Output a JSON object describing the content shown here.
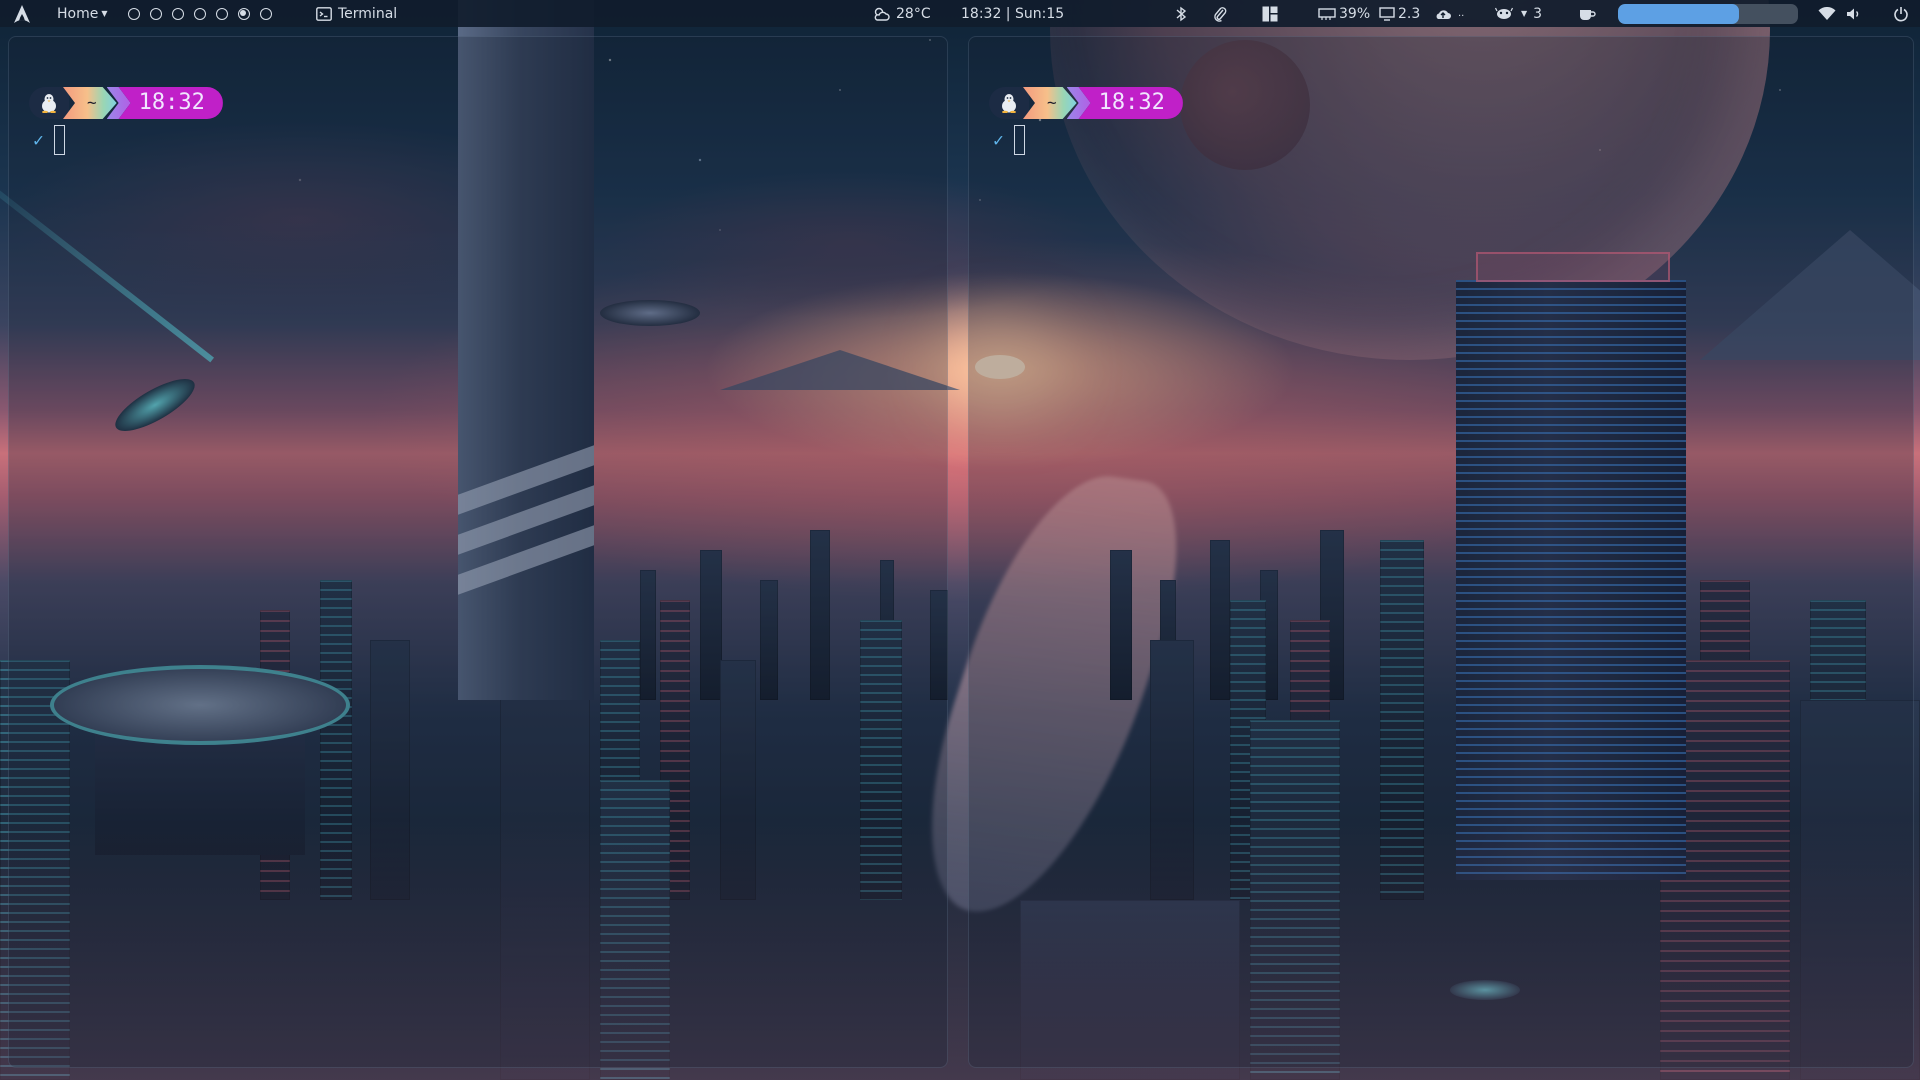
{
  "panel": {
    "launcher_icon": "arch-linux-icon",
    "home_menu": {
      "label": "Home",
      "icon": "caret-down-icon"
    },
    "workspaces": [
      {
        "active": false
      },
      {
        "active": false
      },
      {
        "active": false
      },
      {
        "active": false
      },
      {
        "active": false
      },
      {
        "active": true
      },
      {
        "active": false
      }
    ],
    "active_window": {
      "icon": "terminal-icon",
      "label": "Terminal"
    },
    "weather": {
      "icon": "weather-cloud-sun-icon",
      "text": "28°C"
    },
    "clock": {
      "text": "18:32 | Sun:15"
    },
    "tray": {
      "bluetooth_icon": "bluetooth-icon",
      "clip_icon": "paperclip-icon",
      "layout_icon": "layout-tile-icon",
      "memory": {
        "icon": "ram-icon",
        "text": "39%"
      },
      "cpu": {
        "icon": "monitor-icon",
        "text": "2.3"
      },
      "cloud": {
        "icon": "cloud-upload-icon",
        "text": ""
      },
      "updates": {
        "icon": "package-icon",
        "text": "3"
      },
      "cup_icon": "coffee-cup-icon",
      "volume_level": 0.67,
      "wifi_icon": "wifi-icon",
      "speaker_icon": "speaker-icon",
      "power_icon": "power-icon"
    }
  },
  "terminals": [
    {
      "prompt": {
        "os_icon": "tux-icon",
        "dir": "~",
        "time": "18:32"
      },
      "status_icon": "checkmark-icon"
    },
    {
      "prompt": {
        "os_icon": "tux-icon",
        "dir": "~",
        "time": "18:32"
      },
      "status_icon": "checkmark-icon"
    }
  ],
  "colors": {
    "panel_bg": "#101c2c",
    "panel_text": "#d6dde6",
    "volume_fill": "#5da0e4",
    "prompt_time_bg": "#c020c8",
    "checkmark": "#5fb4ea"
  }
}
